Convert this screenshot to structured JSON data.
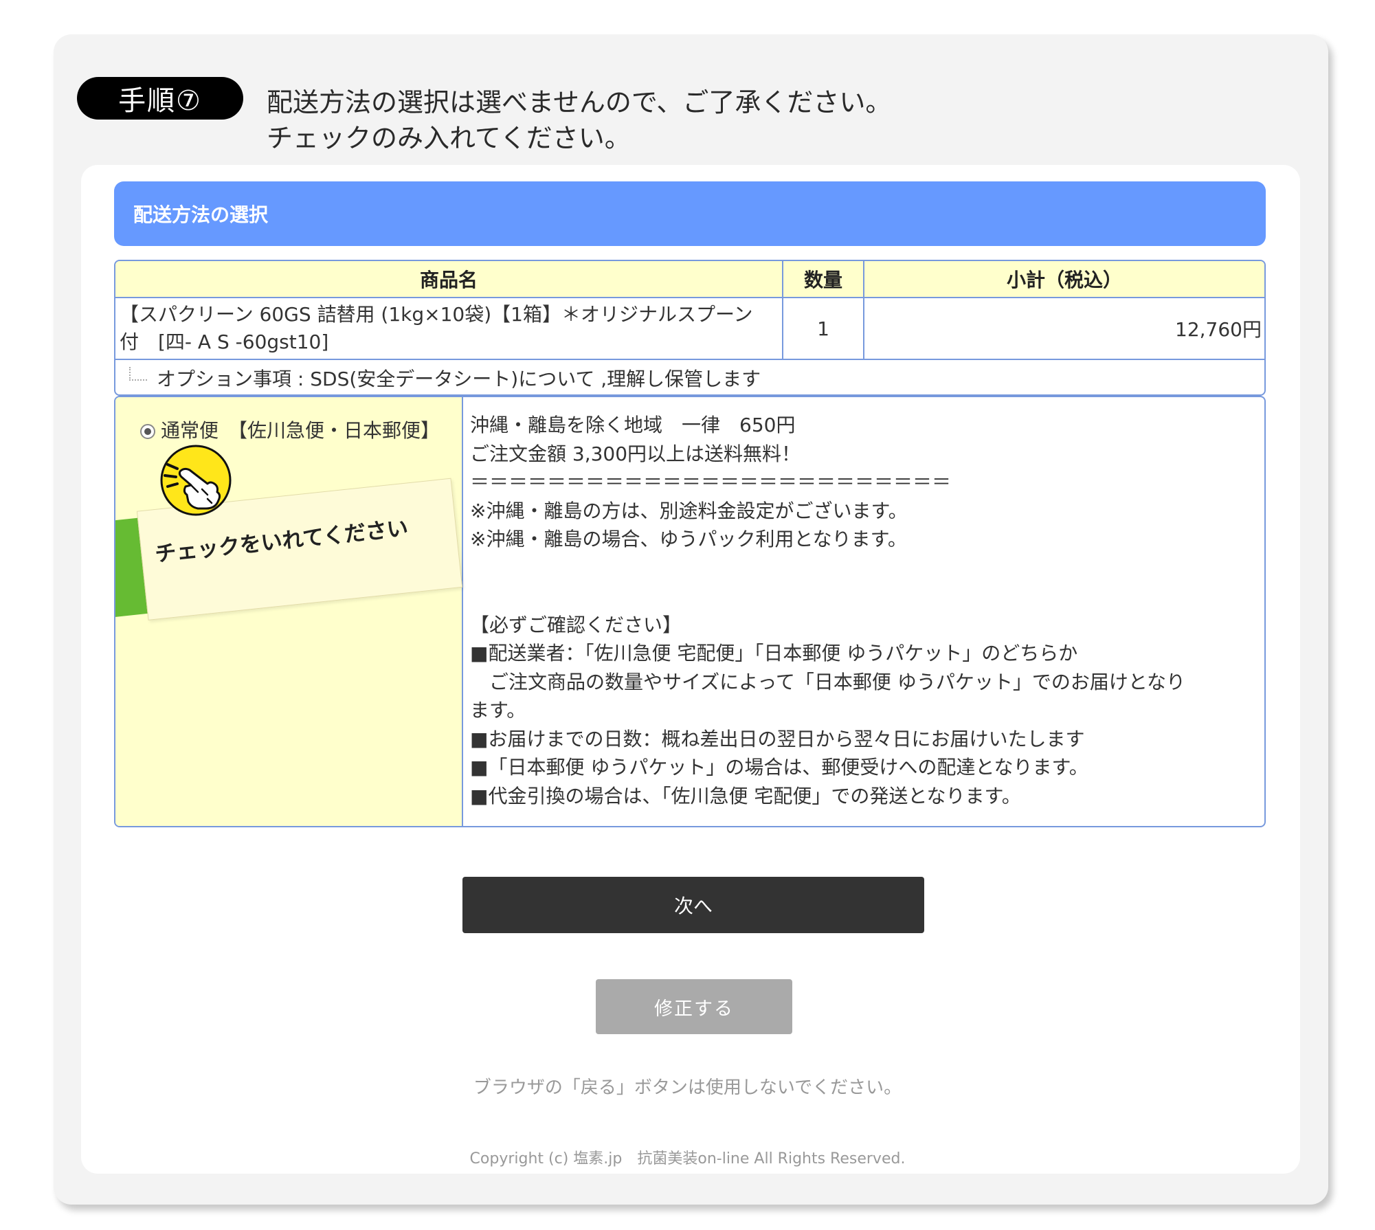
{
  "step": {
    "badge": "手順⑦",
    "line1": "配送方法の選択は選べませんので、ご了承ください。",
    "line2": "チェックのみ入れてください。"
  },
  "section": {
    "title": "配送方法の選択"
  },
  "product_table": {
    "headers": [
      "商品名",
      "数量",
      "小計（税込）"
    ],
    "rows": [
      {
        "name_line1": "【スパクリーン 60GS 詰替用 (1kg×10袋)【1箱】＊オリジナルスプーン",
        "name_line2": "付　[四- A S -60gst10]",
        "qty": "1",
        "subtotal": "12,760円"
      }
    ],
    "option": "オプション事項 : SDS(安全データシート)について ,理解し保管します"
  },
  "shipping": {
    "selected": true,
    "method_label": "通常便　【佐川急便・日本郵便】",
    "callout": "チェックをいれてください",
    "details": [
      "沖縄・離島を除く地域　一律　650円",
      "ご注文金額 3,300円以上は送料無料！",
      "＝＝＝＝＝＝＝＝＝＝＝＝＝＝＝＝＝＝＝＝＝＝＝＝＝",
      "※沖縄・離島の方は、別途料金設定がございます。",
      "※沖縄・離島の場合、ゆうパック利用となります。",
      "",
      "",
      "【必ずご確認ください】",
      "■配送業者：「佐川急便 宅配便」「日本郵便 ゆうパケット」のどちらか",
      "　ご注文商品の数量やサイズによって「日本郵便 ゆうパケット」でのお届けとなり",
      "ます。",
      "■お届けまでの日数：概ね差出日の翌日から翌々日にお届けいたします",
      "■「日本郵便 ゆうパケット」の場合は、郵便受けへの配達となります。",
      "■代金引換の場合は、「佐川急便 宅配便」での発送となります。"
    ]
  },
  "buttons": {
    "next": "次へ",
    "fix": "修正する"
  },
  "back_note": "ブラウザの「戻る」ボタンは使用しないでください。",
  "copyright": "Copyright (c) 塩素.jp　抗菌美装on-line All Rights Reserved.",
  "colors": {
    "header_blue": "#6699ff",
    "cell_yellow": "#ffffcc",
    "next_button": "#333333",
    "fix_button": "#aaaaaa",
    "tab_green": "#66bb33"
  },
  "icons": {
    "pointer": "pointing-hand-icon"
  }
}
